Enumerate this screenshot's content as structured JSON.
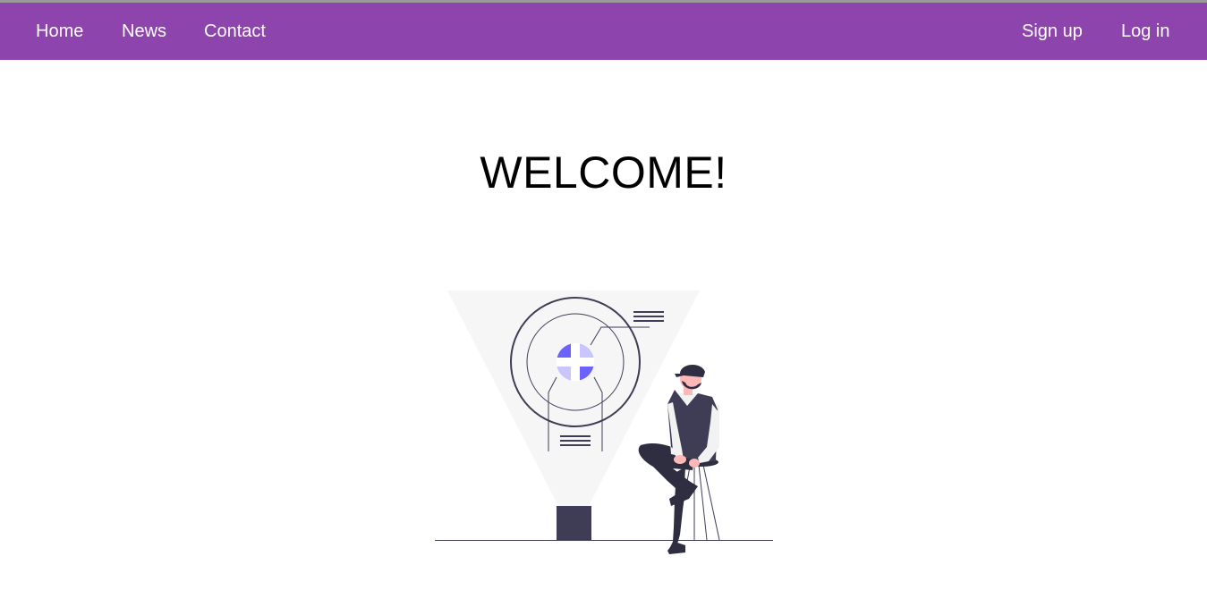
{
  "nav": {
    "left": [
      {
        "label": "Home"
      },
      {
        "label": "News"
      },
      {
        "label": "Contact"
      }
    ],
    "right": [
      {
        "label": "Sign up"
      },
      {
        "label": "Log in"
      }
    ]
  },
  "main": {
    "heading": "WELCOME!"
  },
  "colors": {
    "navbar": "#8e44ad",
    "nav_text": "#ffffff",
    "illustration_accent": "#6c63ff",
    "illustration_dark": "#3f3d56",
    "beam": "#f2f2f2"
  },
  "illustration": {
    "name": "person-with-hologram-illustration"
  }
}
